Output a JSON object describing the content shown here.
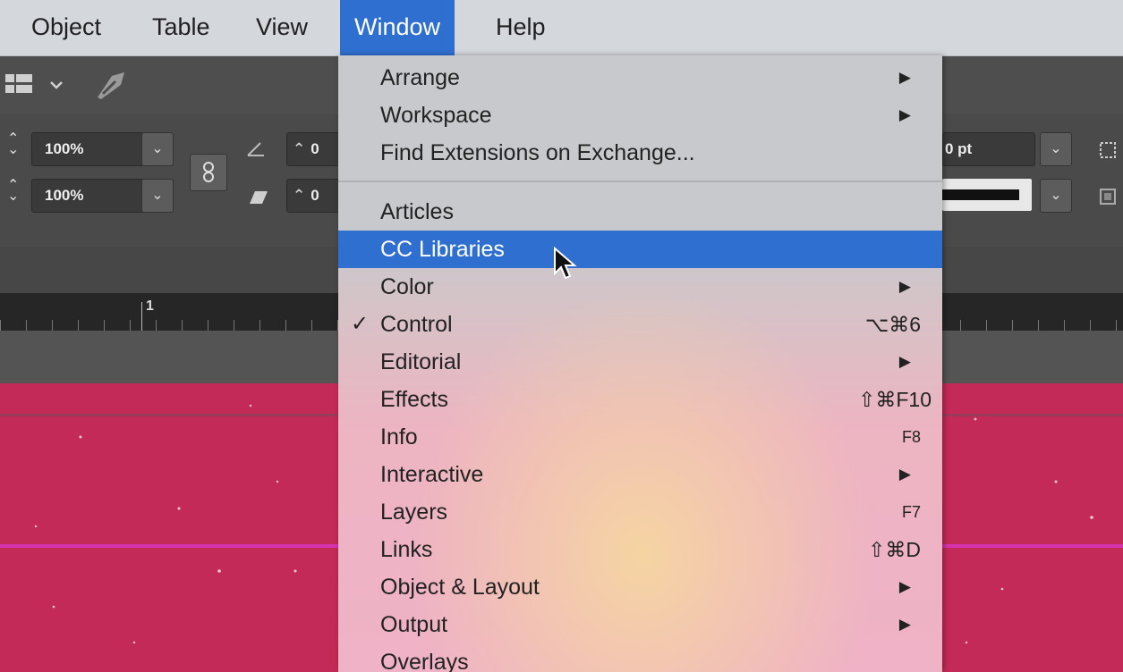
{
  "menubar": {
    "items": [
      {
        "label": "Object",
        "active": false
      },
      {
        "label": "Table",
        "active": false
      },
      {
        "label": "View",
        "active": false
      },
      {
        "label": "Window",
        "active": true
      },
      {
        "label": "Help",
        "active": false
      }
    ]
  },
  "control_panel": {
    "scale_x": "100%",
    "scale_y": "100%",
    "angle_partial": "0",
    "shear_partial": "0",
    "stroke_weight": "0 pt",
    "ruler_mark": "1"
  },
  "window_menu": {
    "items": [
      {
        "label": "Arrange",
        "submenu": true,
        "shortcut": "",
        "checked": false,
        "highlighted": false
      },
      {
        "label": "Workspace",
        "submenu": true,
        "shortcut": "",
        "checked": false,
        "highlighted": false
      },
      {
        "label": "Find Extensions on Exchange...",
        "submenu": false,
        "shortcut": "",
        "checked": false,
        "highlighted": false
      },
      {
        "label": "Articles",
        "submenu": false,
        "shortcut": "",
        "checked": false,
        "highlighted": false
      },
      {
        "label": "CC Libraries",
        "submenu": false,
        "shortcut": "",
        "checked": false,
        "highlighted": true
      },
      {
        "label": "Color",
        "submenu": true,
        "shortcut": "",
        "checked": false,
        "highlighted": false
      },
      {
        "label": "Control",
        "submenu": false,
        "shortcut": "⌥⌘6",
        "checked": true,
        "highlighted": false
      },
      {
        "label": "Editorial",
        "submenu": true,
        "shortcut": "",
        "checked": false,
        "highlighted": false
      },
      {
        "label": "Effects",
        "submenu": false,
        "shortcut": "⇧⌘F10",
        "checked": false,
        "highlighted": false
      },
      {
        "label": "Info",
        "submenu": false,
        "shortcut": "F8",
        "checked": false,
        "highlighted": false
      },
      {
        "label": "Interactive",
        "submenu": true,
        "shortcut": "",
        "checked": false,
        "highlighted": false
      },
      {
        "label": "Layers",
        "submenu": false,
        "shortcut": "F7",
        "checked": false,
        "highlighted": false
      },
      {
        "label": "Links",
        "submenu": false,
        "shortcut": "⇧⌘D",
        "checked": false,
        "highlighted": false
      },
      {
        "label": "Object & Layout",
        "submenu": true,
        "shortcut": "",
        "checked": false,
        "highlighted": false
      },
      {
        "label": "Output",
        "submenu": true,
        "shortcut": "",
        "checked": false,
        "highlighted": false
      },
      {
        "label": "Overlays",
        "submenu": false,
        "shortcut": "",
        "checked": false,
        "highlighted": false
      }
    ],
    "submenu_glyph": "▶",
    "check_glyph": "✓"
  },
  "colors": {
    "menubar_bg": "#d4d7dc",
    "menu_highlight": "#2f6fd0",
    "page_fill": "#c42a57",
    "guide_magenta": "#d633b0"
  },
  "icons": [
    "layout-icon",
    "chevron-down-icon",
    "pen-tool-icon",
    "angle-icon",
    "shear-icon",
    "link-chain-icon",
    "stepper-icon",
    "frame-icon",
    "arrow-cursor-icon"
  ]
}
